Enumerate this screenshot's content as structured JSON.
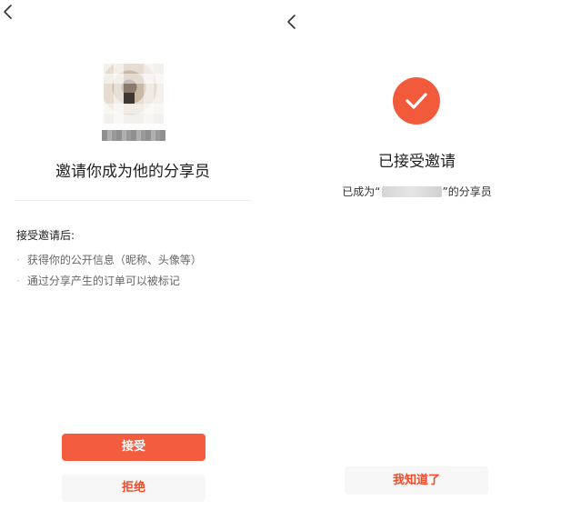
{
  "invite_screen": {
    "invite_title": "邀请你成为他的分享员",
    "after_accept_title": "接受邀请后:",
    "benefits": [
      "获得你的公开信息（昵称、头像等）",
      "通过分享产生的订单可以被标记"
    ],
    "accept_label": "接受",
    "reject_label": "拒绝"
  },
  "success_screen": {
    "title": "已接受邀请",
    "desc_prefix": "已成为“",
    "desc_suffix": "”的分享员",
    "got_it_label": "我知道了"
  },
  "colors": {
    "accent": "#f35c3f",
    "reject_text": "#ef4a2a",
    "secondary_button_bg": "#f7f7f7"
  },
  "icons": {
    "back": "chevron-left-icon",
    "success": "checkmark-circle-icon"
  }
}
